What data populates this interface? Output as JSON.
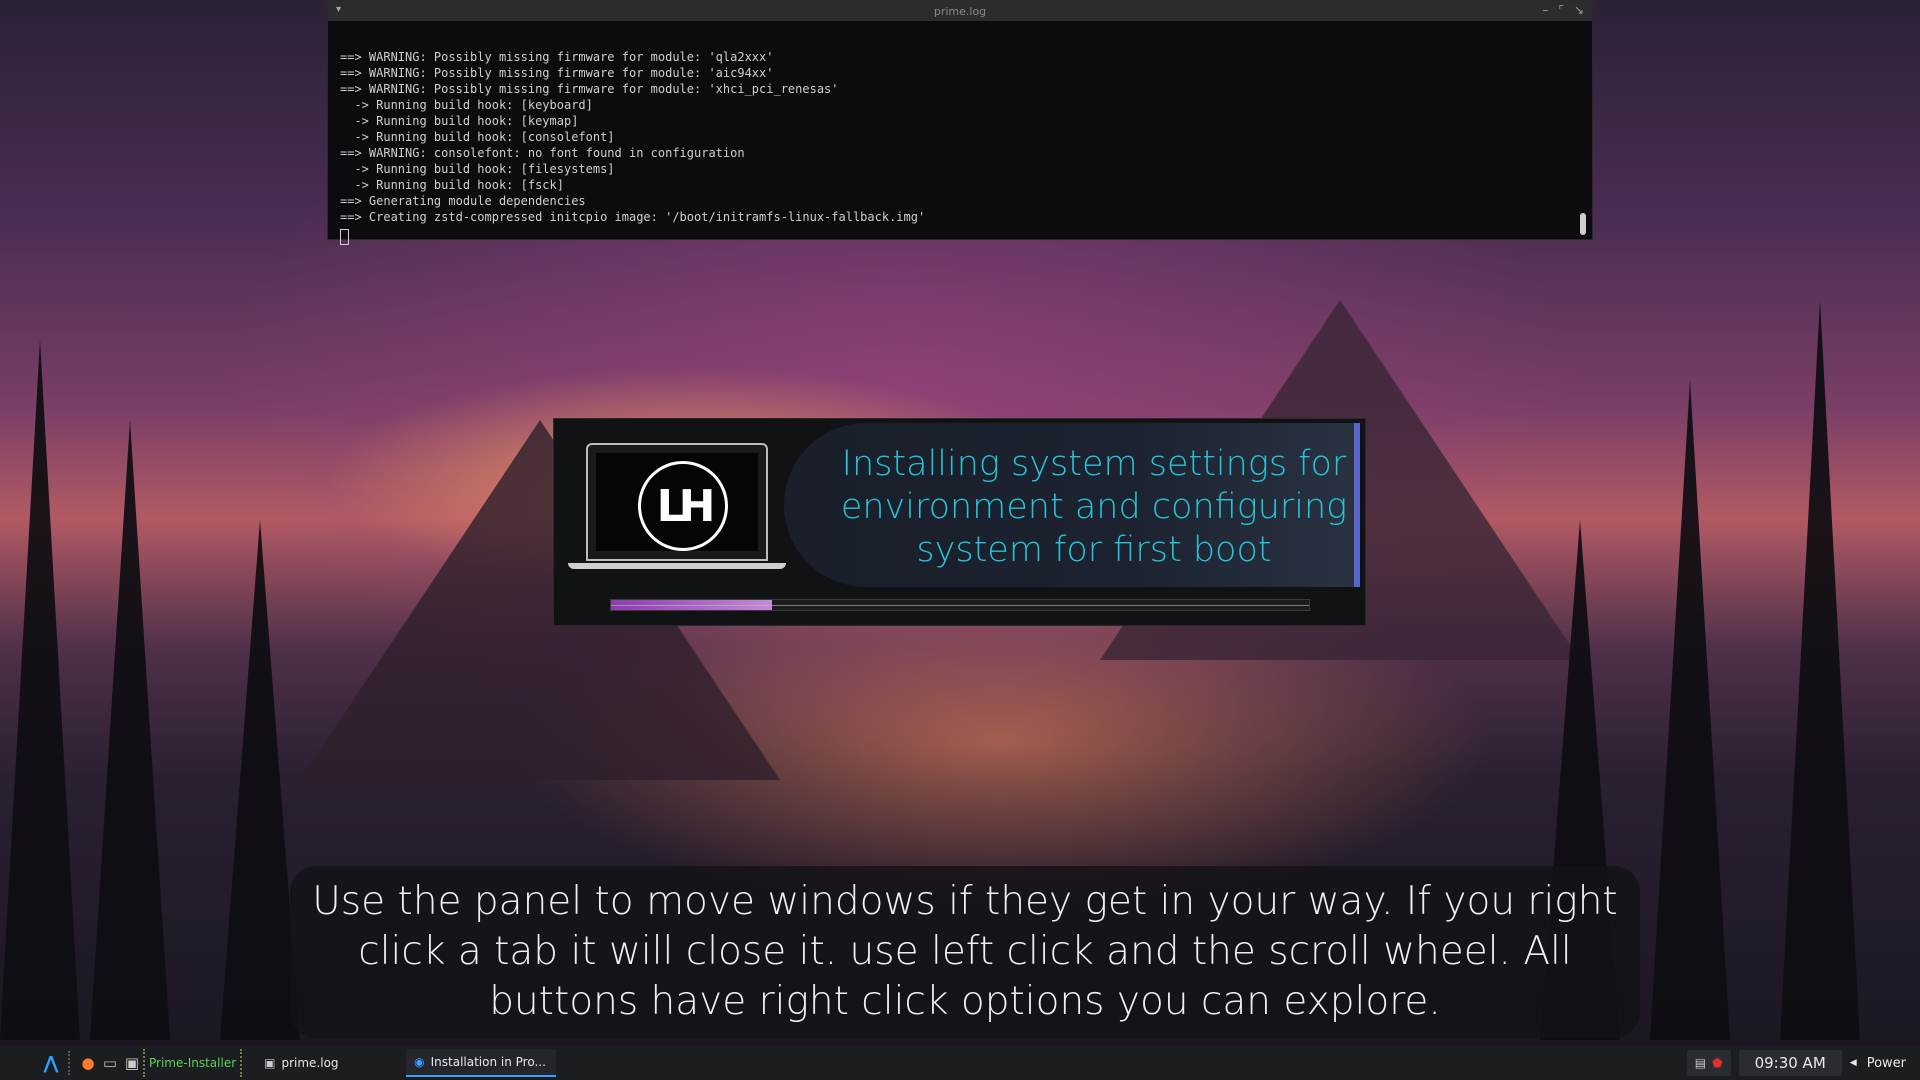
{
  "terminal": {
    "title": "prime.log",
    "lines": [
      "==> WARNING: Possibly missing firmware for module: 'qla2xxx'",
      "==> WARNING: Possibly missing firmware for module: 'aic94xx'",
      "==> WARNING: Possibly missing firmware for module: 'xhci_pci_renesas'",
      "  -> Running build hook: [keyboard]",
      "  -> Running build hook: [keymap]",
      "  -> Running build hook: [consolefont]",
      "==> WARNING: consolefont: no font found in configuration",
      "  -> Running build hook: [filesystems]",
      "  -> Running build hook: [fsck]",
      "==> Generating module dependencies",
      "==> Creating zstd-compressed initcpio image: '/boot/initramfs-linux-fallback.img'"
    ]
  },
  "installer": {
    "logo_text": "LH",
    "status": "Installing system settings for environment and configuring system for first boot",
    "progress_fraction": 0.23
  },
  "tip": {
    "text": "Use the panel to move windows if they get in your way. If you right click a tab it will close it. use left click and the scroll wheel. All buttons have right click options you can explore."
  },
  "taskbar": {
    "prime_installer_label": "Prime-Installer",
    "tasks": [
      {
        "label": "prime.log",
        "icon": "terminal-icon"
      },
      {
        "label": "Installation in Pro...",
        "icon": "installer-icon"
      }
    ],
    "clock": "09:30 AM",
    "power_label": "Power"
  },
  "colors": {
    "status_text": "#27c3d6",
    "progress": "#a24fc4",
    "prime_installer": "#5ad15a"
  }
}
